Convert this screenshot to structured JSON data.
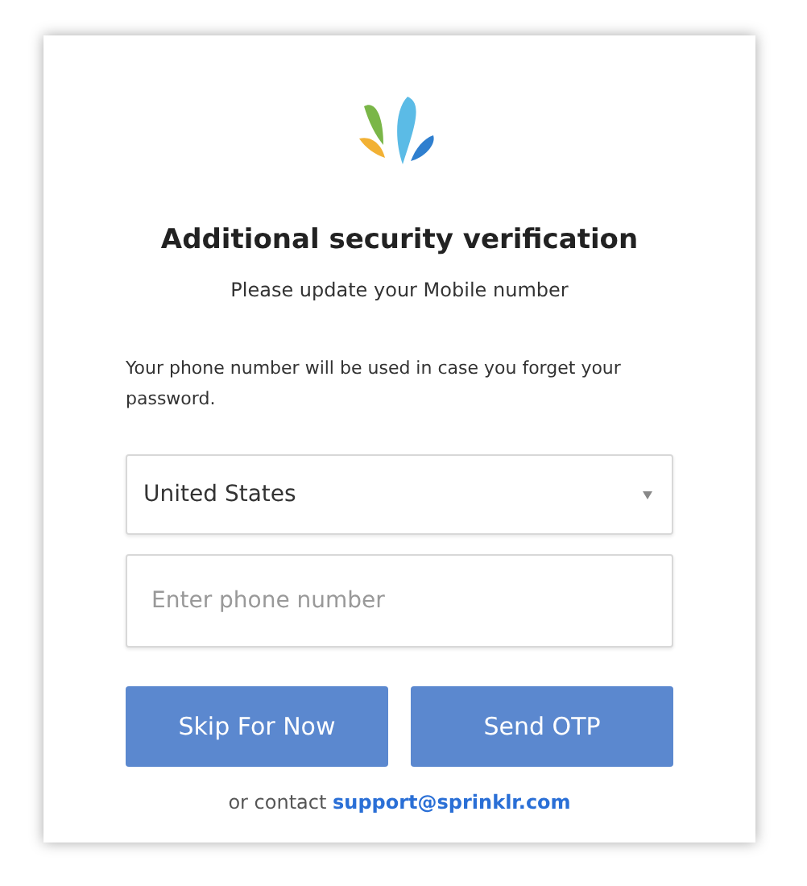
{
  "title": "Additional security verification",
  "subtitle": "Please update your Mobile number",
  "note": "Your phone number will be used in case you forget your password.",
  "country_select": {
    "value": "United States"
  },
  "phone_field": {
    "placeholder": "Enter phone number"
  },
  "buttons": [
    "Skip For Now",
    "Send OTP"
  ],
  "contact": {
    "text": "or contact",
    "link": "support@sprinklr.com"
  }
}
